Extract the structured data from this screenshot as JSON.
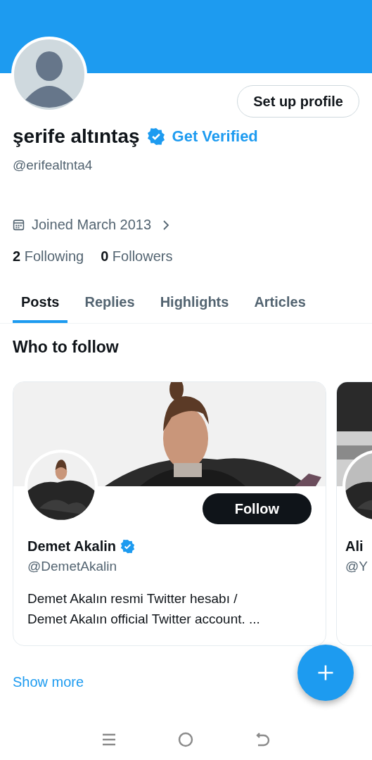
{
  "profile": {
    "setup_button": "Set up profile",
    "name": "şerife altıntaş",
    "verified": true,
    "get_verified": "Get Verified",
    "handle": "@erifealtnta4",
    "joined": "Joined March 2013",
    "following_count": "2",
    "following_label": "Following",
    "followers_count": "0",
    "followers_label": "Followers"
  },
  "tabs": [
    {
      "label": "Posts",
      "selected": true
    },
    {
      "label": "Replies",
      "selected": false
    },
    {
      "label": "Highlights",
      "selected": false
    },
    {
      "label": "Articles",
      "selected": false
    }
  ],
  "who_to_follow": {
    "title": "Who to follow",
    "cards": [
      {
        "name": "Demet Akalin",
        "verified": true,
        "handle": "@DemetAkalin",
        "bio": "Demet Akalın resmi Twitter hesabı / Demet Akalın official Twitter account. ...",
        "follow_button": "Follow"
      },
      {
        "name": "Ali",
        "handle": "@Y"
      }
    ],
    "show_more": "Show more"
  }
}
